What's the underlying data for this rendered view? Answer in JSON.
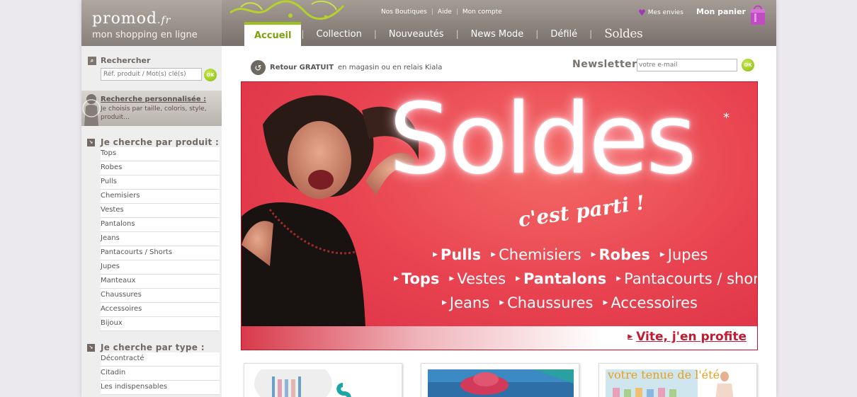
{
  "brand": {
    "logo": "promod",
    "logo_suffix": ".fr",
    "tagline": "mon shopping en ligne"
  },
  "top_links": [
    "Nos Boutiques",
    "Aide",
    "Mon compte"
  ],
  "top_links_separator": "|",
  "wishlist_label": "Mes envies",
  "cart_label": "Mon panier",
  "nav": {
    "items": [
      "Accueil",
      "Collection",
      "Nouveautés",
      "News Mode",
      "Défilé",
      "Soldes"
    ],
    "active": "Accueil",
    "separator": "|"
  },
  "sidebar": {
    "search": {
      "title": "Rechercher",
      "placeholder": "Réf. produit / Mot(s) clé(s)",
      "button": "OK"
    },
    "personalized": {
      "title": "Recherche personnalisée :",
      "description": "Je choisis par taille, coloris, style, produit..."
    },
    "by_product": {
      "title": "Je cherche par produit :",
      "items": [
        "Tops",
        "Robes",
        "Pulls",
        "Chemisiers",
        "Vestes",
        "Pantalons",
        "Jeans",
        "Pantacourts / Shorts",
        "Jupes",
        "Manteaux",
        "Chaussures",
        "Accessoires",
        "Bijoux"
      ]
    },
    "by_type": {
      "title": "Je cherche par type :",
      "items": [
        "Décontracté",
        "Citadin",
        "Les indispensables"
      ]
    }
  },
  "main": {
    "retour": {
      "bold": "Retour GRATUIT",
      "text": "en magasin ou en relais Kiala"
    },
    "newsletter": {
      "label": "Newsletter :",
      "placeholder": "votre e-mail",
      "button": "OK"
    },
    "banner": {
      "title": "Soldes",
      "star": "*",
      "subtitle": "c'est parti !",
      "row1": [
        {
          "label": "Pulls",
          "bold": true
        },
        {
          "label": "Chemisiers",
          "bold": false
        },
        {
          "label": "Robes",
          "bold": true
        },
        {
          "label": "Jupes",
          "bold": false
        }
      ],
      "row2": [
        {
          "label": "Tops",
          "bold": true
        },
        {
          "label": "Vestes",
          "bold": false
        },
        {
          "label": "Pantalons",
          "bold": true
        },
        {
          "label": "Pantacourts / shorts",
          "bold": false
        }
      ],
      "row3": [
        {
          "label": "Jeans",
          "bold": false
        },
        {
          "label": "Chaussures",
          "bold": false
        },
        {
          "label": "Accessoires",
          "bold": false
        }
      ],
      "cta": "Vite, j'en profite"
    },
    "thumbs": {
      "third_text": "votre tenue de l'été"
    }
  },
  "colors": {
    "accent_green": "#9cc21e",
    "banner_red": "#e84250",
    "header_taupe": "#8a807a",
    "cta_red": "#c41a32"
  }
}
